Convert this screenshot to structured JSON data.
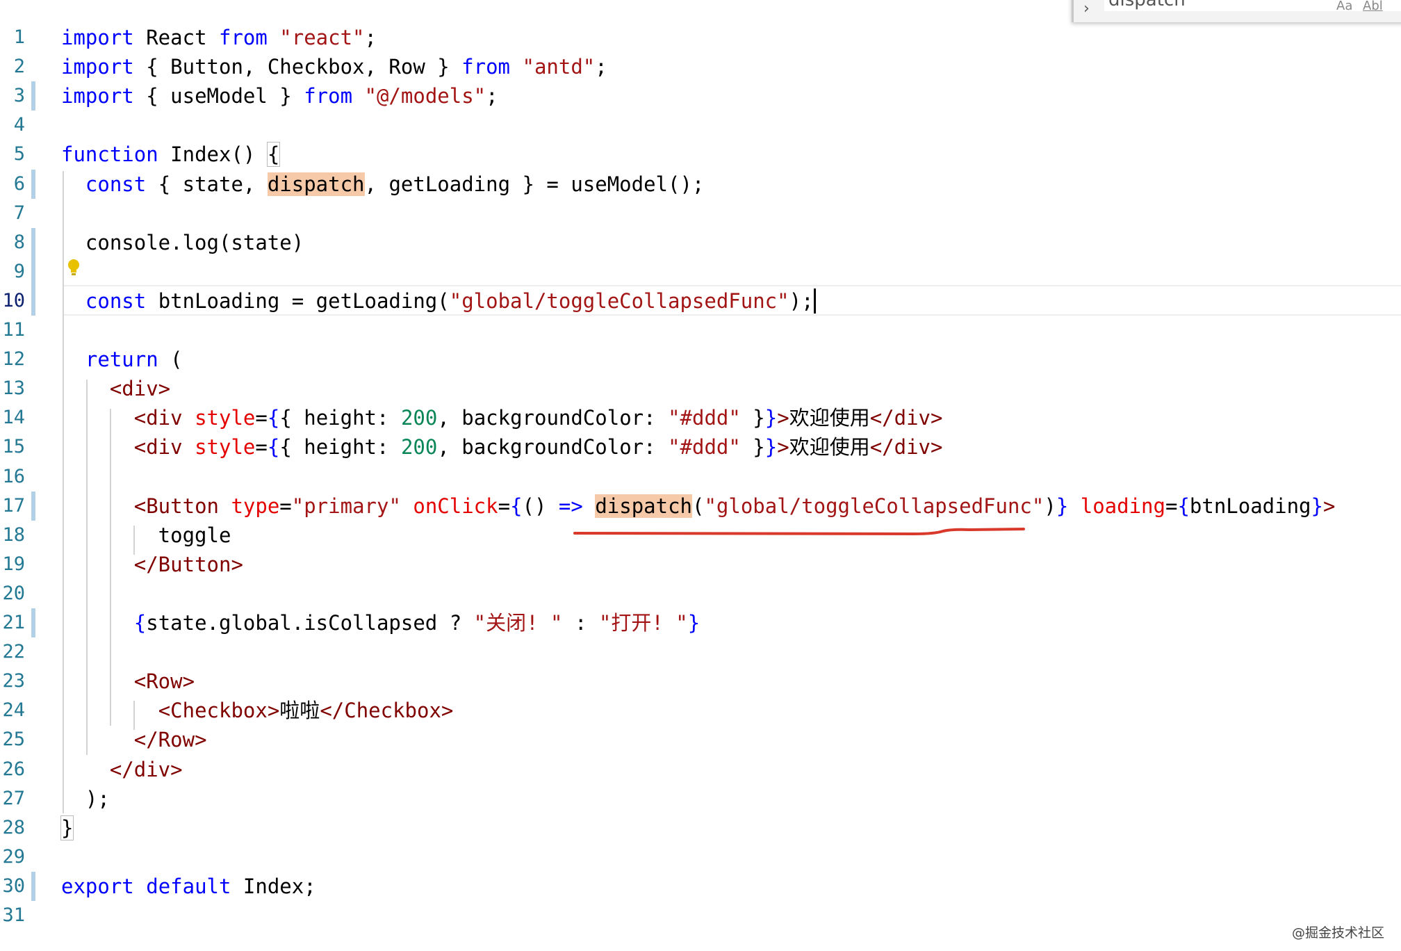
{
  "find_widget": {
    "query": "dispatch",
    "toggle_icon": "chevron-right-icon",
    "match_case_label": "Aa",
    "match_word_label": "Abl"
  },
  "editor": {
    "current_line": 10,
    "lines": [
      {
        "n": "1",
        "tokens": [
          [
            "k",
            "import"
          ],
          [
            "p",
            " React "
          ],
          [
            "k",
            "from"
          ],
          [
            "p",
            " "
          ],
          [
            "s",
            "\"react\""
          ],
          [
            "p",
            ";"
          ]
        ]
      },
      {
        "n": "2",
        "tokens": [
          [
            "k",
            "import"
          ],
          [
            "p",
            " { Button, Checkbox, Row } "
          ],
          [
            "k",
            "from"
          ],
          [
            "p",
            " "
          ],
          [
            "s",
            "\"antd\""
          ],
          [
            "p",
            ";"
          ]
        ]
      },
      {
        "n": "3",
        "tokens": [
          [
            "k",
            "import"
          ],
          [
            "p",
            " { useModel } "
          ],
          [
            "k",
            "from"
          ],
          [
            "p",
            " "
          ],
          [
            "s",
            "\"@/models\""
          ],
          [
            "p",
            ";"
          ]
        ],
        "modified": true
      },
      {
        "n": "4",
        "tokens": []
      },
      {
        "n": "5",
        "tokens": [
          [
            "k",
            "function"
          ],
          [
            "p",
            " Index() "
          ],
          [
            "br",
            "{"
          ]
        ]
      },
      {
        "n": "6",
        "tokens": [
          [
            "p",
            "  "
          ],
          [
            "k",
            "const"
          ],
          [
            "p",
            " { state, "
          ],
          [
            "hl",
            "dispatch"
          ],
          [
            "p",
            ", getLoading } = useModel();"
          ]
        ],
        "modified": true
      },
      {
        "n": "7",
        "tokens": []
      },
      {
        "n": "8",
        "tokens": [
          [
            "p",
            "  console.log(state)"
          ]
        ],
        "modified": true
      },
      {
        "n": "9",
        "tokens": [],
        "modified": true
      },
      {
        "n": "10",
        "tokens": [
          [
            "p",
            "  "
          ],
          [
            "k",
            "const"
          ],
          [
            "p",
            " btnLoading = getLoading("
          ],
          [
            "s",
            "\"global/toggleCollapsedFunc\""
          ],
          [
            "p",
            ");"
          ]
        ],
        "modified": true,
        "cursor": true
      },
      {
        "n": "11",
        "tokens": []
      },
      {
        "n": "12",
        "tokens": [
          [
            "p",
            "  "
          ],
          [
            "k",
            "return"
          ],
          [
            "p",
            " ("
          ]
        ]
      },
      {
        "n": "13",
        "tokens": [
          [
            "p",
            "    "
          ],
          [
            "t",
            "<div>"
          ]
        ]
      },
      {
        "n": "14",
        "tokens": [
          [
            "p",
            "      "
          ],
          [
            "t",
            "<div"
          ],
          [
            "p",
            " "
          ],
          [
            "a",
            "style"
          ],
          [
            "p",
            "="
          ],
          [
            "k",
            "{"
          ],
          [
            "p",
            "{ height: "
          ],
          [
            "n",
            "200"
          ],
          [
            "p",
            ", backgroundColor: "
          ],
          [
            "s",
            "\"#ddd\""
          ],
          [
            "p",
            " }"
          ],
          [
            "k",
            "}"
          ],
          [
            "t",
            ">"
          ],
          [
            "p",
            "欢迎使用"
          ],
          [
            "t",
            "</div>"
          ]
        ]
      },
      {
        "n": "15",
        "tokens": [
          [
            "p",
            "      "
          ],
          [
            "t",
            "<div"
          ],
          [
            "p",
            " "
          ],
          [
            "a",
            "style"
          ],
          [
            "p",
            "="
          ],
          [
            "k",
            "{"
          ],
          [
            "p",
            "{ height: "
          ],
          [
            "n",
            "200"
          ],
          [
            "p",
            ", backgroundColor: "
          ],
          [
            "s",
            "\"#ddd\""
          ],
          [
            "p",
            " }"
          ],
          [
            "k",
            "}"
          ],
          [
            "t",
            ">"
          ],
          [
            "p",
            "欢迎使用"
          ],
          [
            "t",
            "</div>"
          ]
        ]
      },
      {
        "n": "16",
        "tokens": []
      },
      {
        "n": "17",
        "tokens": [
          [
            "p",
            "      "
          ],
          [
            "t",
            "<Button"
          ],
          [
            "p",
            " "
          ],
          [
            "a",
            "type"
          ],
          [
            "p",
            "="
          ],
          [
            "s",
            "\"primary\""
          ],
          [
            "p",
            " "
          ],
          [
            "a",
            "onClick"
          ],
          [
            "p",
            "="
          ],
          [
            "k",
            "{"
          ],
          [
            "p",
            "() "
          ],
          [
            "k",
            "=>"
          ],
          [
            "p",
            " "
          ],
          [
            "hl",
            "dispatch"
          ],
          [
            "p",
            "("
          ],
          [
            "s",
            "\"global/toggleCollapsedFunc\""
          ],
          [
            "p",
            ")"
          ],
          [
            "k",
            "}"
          ],
          [
            "p",
            " "
          ],
          [
            "a",
            "loading"
          ],
          [
            "p",
            "="
          ],
          [
            "k",
            "{"
          ],
          [
            "p",
            "btnLoading"
          ],
          [
            "k",
            "}"
          ],
          [
            "t",
            ">"
          ]
        ],
        "modified": true
      },
      {
        "n": "18",
        "tokens": [
          [
            "p",
            "        toggle"
          ]
        ]
      },
      {
        "n": "19",
        "tokens": [
          [
            "p",
            "      "
          ],
          [
            "t",
            "</Button>"
          ]
        ]
      },
      {
        "n": "20",
        "tokens": []
      },
      {
        "n": "21",
        "tokens": [
          [
            "p",
            "      "
          ],
          [
            "k",
            "{"
          ],
          [
            "p",
            "state.global.isCollapsed ? "
          ],
          [
            "s",
            "\"关闭! \""
          ],
          [
            "p",
            " : "
          ],
          [
            "s",
            "\"打开! \""
          ],
          [
            "k",
            "}"
          ]
        ],
        "modified": true
      },
      {
        "n": "22",
        "tokens": []
      },
      {
        "n": "23",
        "tokens": [
          [
            "p",
            "      "
          ],
          [
            "t",
            "<Row>"
          ]
        ]
      },
      {
        "n": "24",
        "tokens": [
          [
            "p",
            "        "
          ],
          [
            "t",
            "<Checkbox>"
          ],
          [
            "p",
            "啦啦"
          ],
          [
            "t",
            "</Checkbox>"
          ]
        ]
      },
      {
        "n": "25",
        "tokens": [
          [
            "p",
            "      "
          ],
          [
            "t",
            "</Row>"
          ]
        ]
      },
      {
        "n": "26",
        "tokens": [
          [
            "p",
            "    "
          ],
          [
            "t",
            "</div>"
          ]
        ]
      },
      {
        "n": "27",
        "tokens": [
          [
            "p",
            "  );"
          ]
        ]
      },
      {
        "n": "28",
        "tokens": [
          [
            "br",
            "}"
          ]
        ]
      },
      {
        "n": "29",
        "tokens": []
      },
      {
        "n": "30",
        "tokens": [
          [
            "k",
            "export"
          ],
          [
            "p",
            " "
          ],
          [
            "k",
            "default"
          ],
          [
            "p",
            " Index;"
          ]
        ],
        "modified": true
      },
      {
        "n": "31",
        "tokens": []
      }
    ]
  },
  "lightbulb_icon": "lightbulb-icon",
  "annotation_icon": "red-underline-annotation",
  "watermark": "@掘金技术社区",
  "colors": {
    "keyword": "#0000ff",
    "string": "#a31515",
    "tag": "#800000",
    "attribute": "#e50000",
    "number": "#098658",
    "line_number": "#237893",
    "find_highlight": "#f6c9a8",
    "gutter_modified": "#b3d1e6",
    "annotation": "#d9392b"
  }
}
